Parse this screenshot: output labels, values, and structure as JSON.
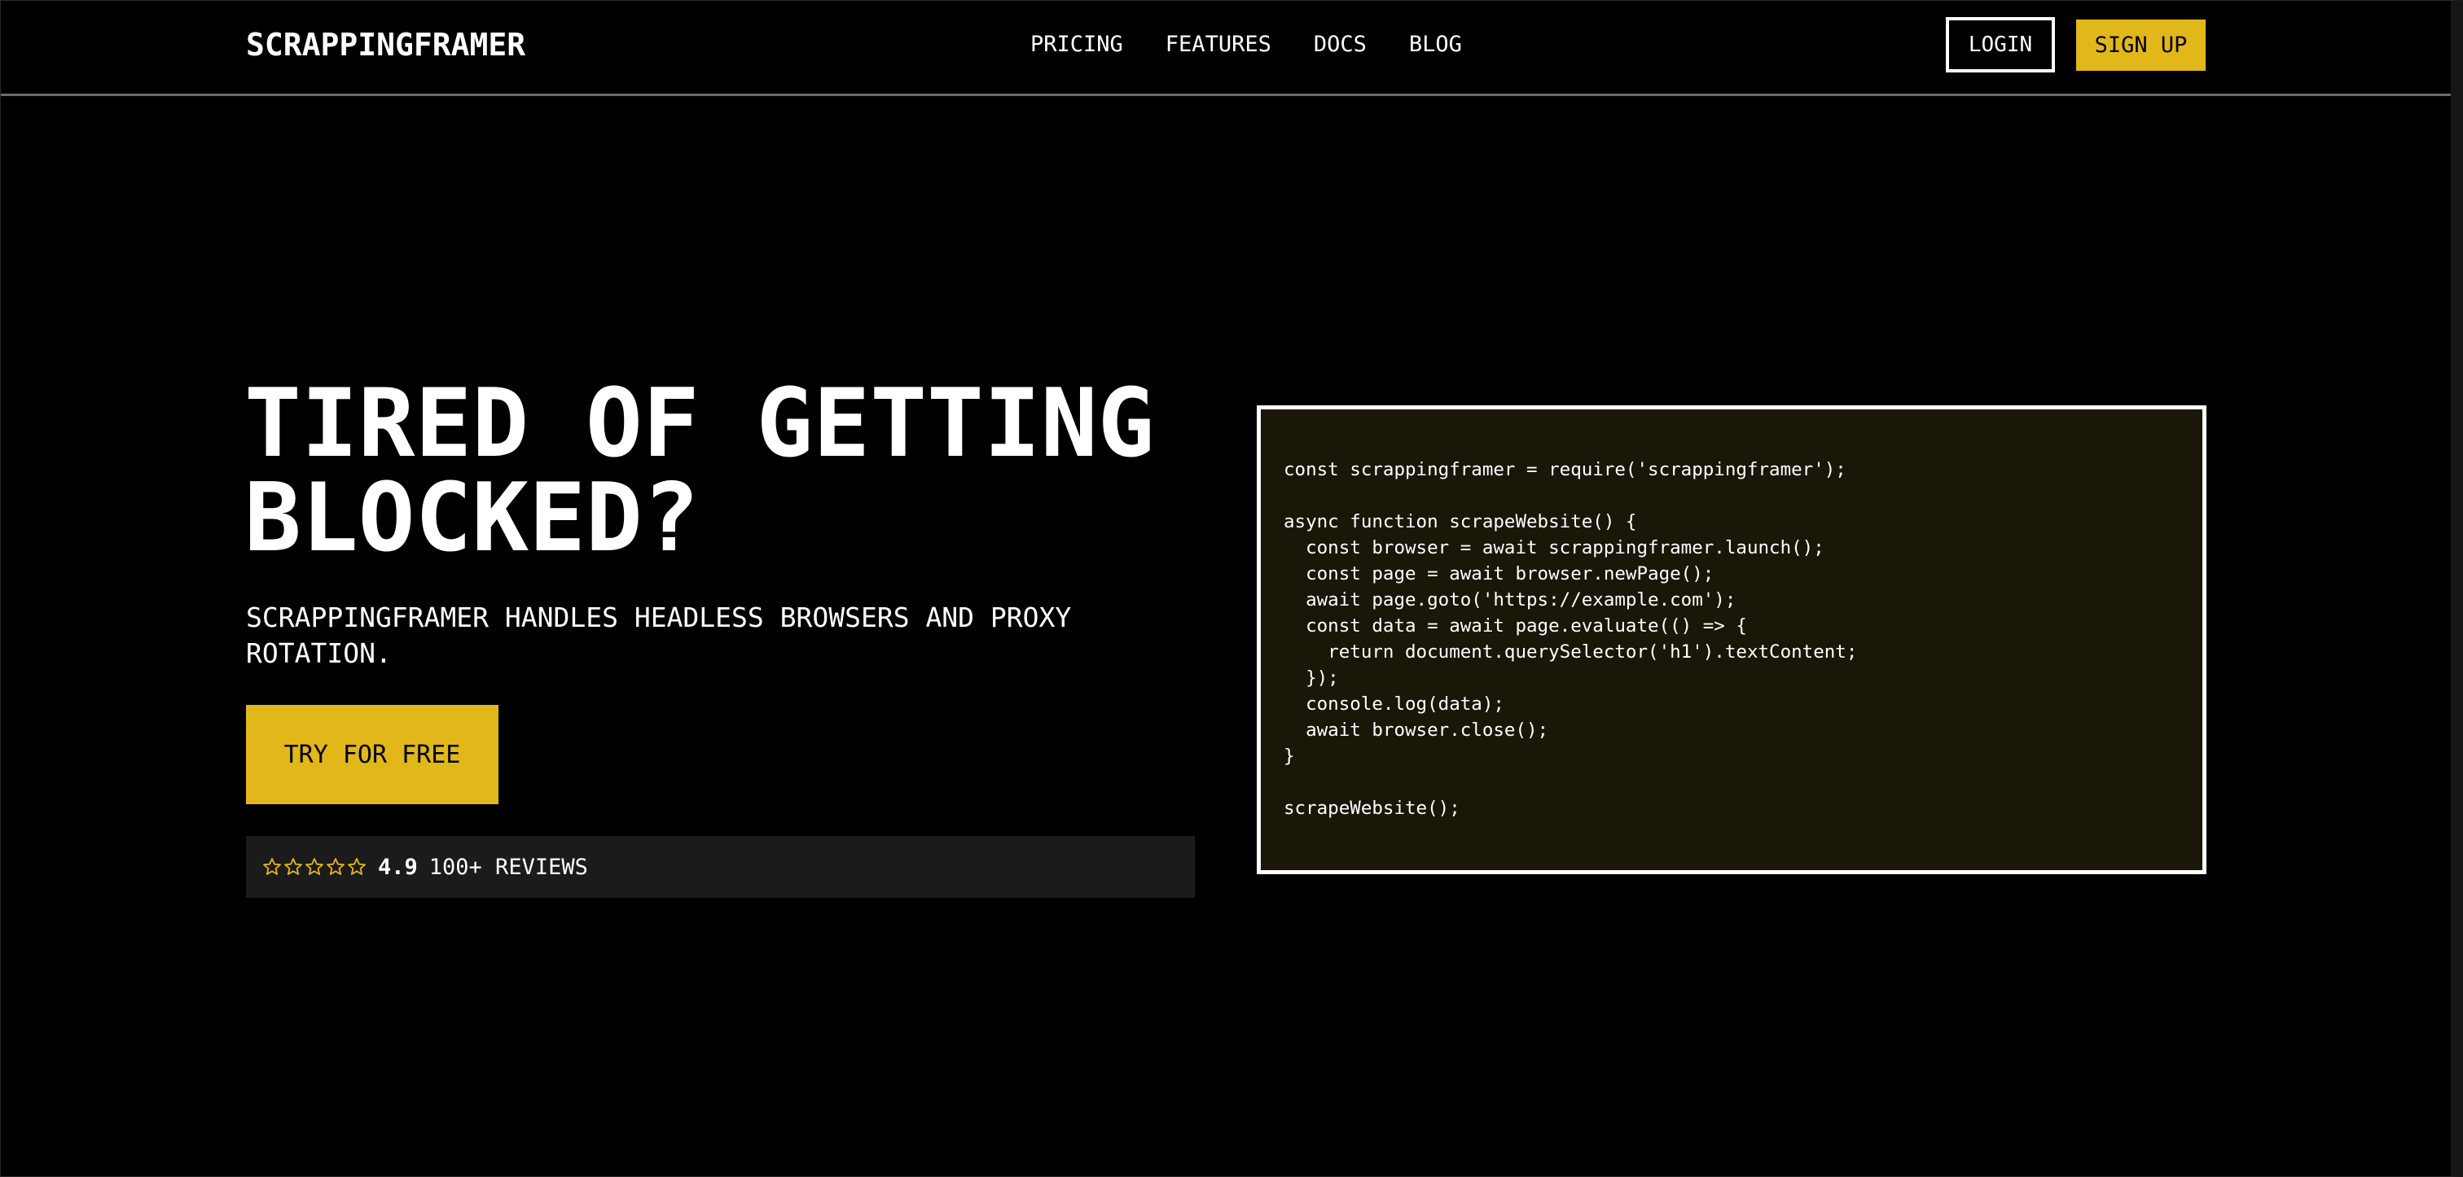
{
  "header": {
    "logo": "SCRAPPINGFRAMER",
    "nav": [
      "PRICING",
      "FEATURES",
      "DOCS",
      "BLOG"
    ],
    "login_label": "LOGIN",
    "signup_label": "SIGN UP"
  },
  "hero": {
    "title_line1": "TIRED OF GETTING",
    "title_line2": "BLOCKED?",
    "subtitle": "SCRAPPINGFRAMER HANDLES HEADLESS BROWSERS AND PROXY ROTATION.",
    "cta_label": "TRY FOR FREE",
    "rating": "4.9",
    "reviews_label": "100+ REVIEWS",
    "stars": 5
  },
  "code": {
    "snippet": "const scrappingframer = require('scrappingframer');\n\nasync function scrapeWebsite() {\n  const browser = await scrappingframer.launch();\n  const page = await browser.newPage();\n  await page.goto('https://example.com');\n  const data = await page.evaluate(() => {\n    return document.querySelector('h1').textContent;\n  });\n  console.log(data);\n  await browser.close();\n}\n\nscrapeWebsite();"
  },
  "colors": {
    "accent": "#e2b71a",
    "background": "#000000",
    "code_background": "#1a1608",
    "review_bar": "#1b1b1b"
  }
}
